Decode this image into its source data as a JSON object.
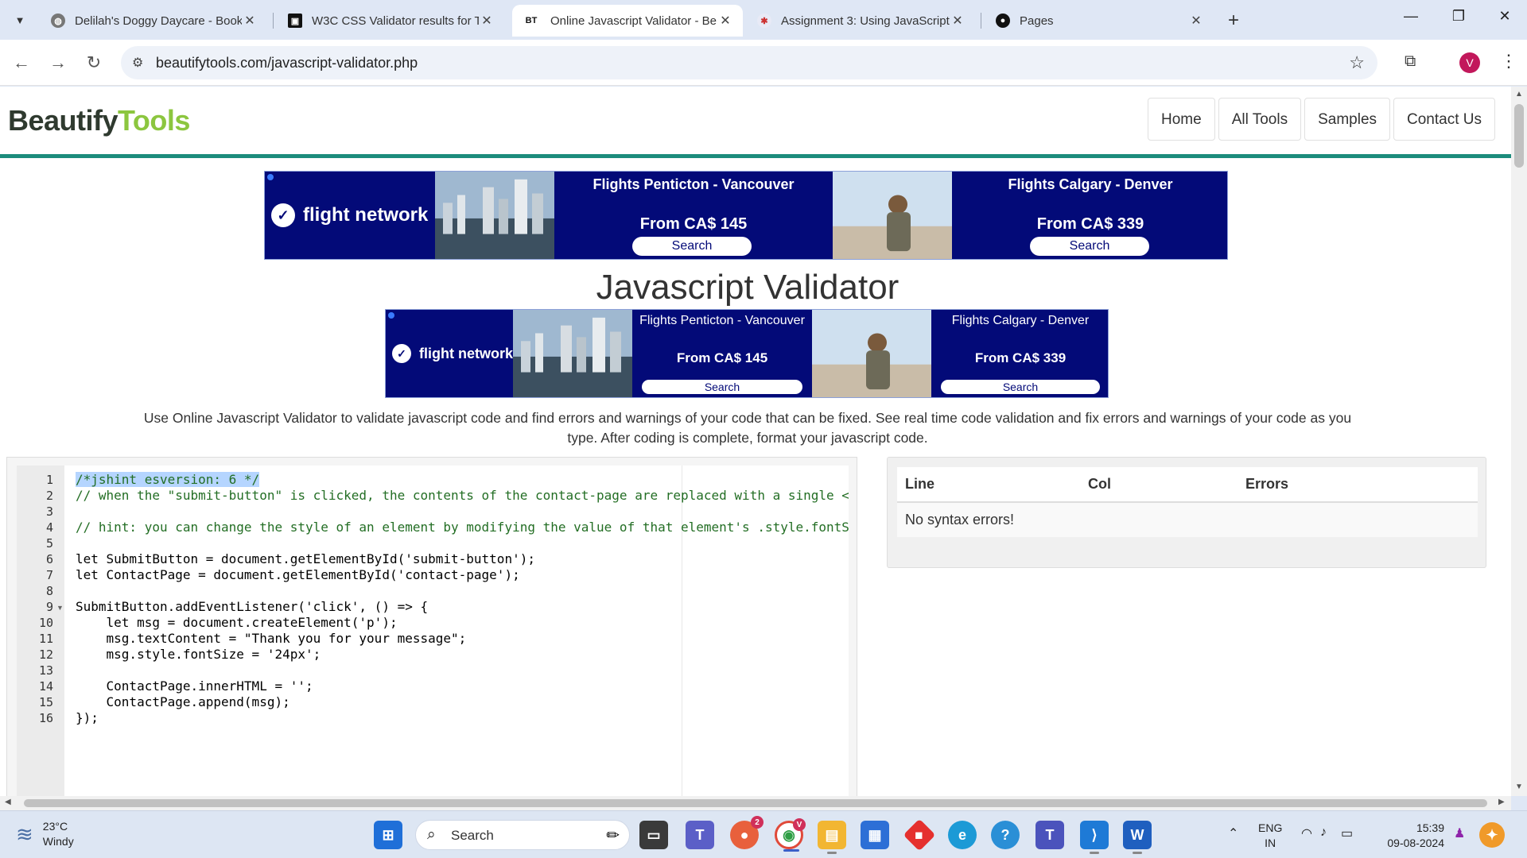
{
  "browser": {
    "tabs": [
      {
        "title": "Delilah's Doggy Daycare - Book",
        "favicon": "globe-icon"
      },
      {
        "title": "W3C CSS Validator results for T",
        "favicon": "w3c-icon"
      },
      {
        "title": "Online Javascript Validator - Be",
        "favicon": "bt-icon",
        "favicon_text": "BT"
      },
      {
        "title": "Assignment 3: Using JavaScript",
        "favicon": "assignment-icon"
      },
      {
        "title": "Pages",
        "favicon": "github-icon"
      }
    ],
    "url": "beautifytools.com/javascript-validator.php",
    "profile_initial": "V"
  },
  "site": {
    "logo_part1": "Beautify",
    "logo_part2": "Tools",
    "nav": [
      "Home",
      "All Tools",
      "Samples",
      "Contact Us"
    ],
    "heading": "Javascript Validator",
    "intro": "Use Online Javascript Validator to validate javascript code and find errors and warnings of your code that can be fixed. See real time code validation and fix errors and warnings of your code as you type. After coding is complete, format your javascript code."
  },
  "ads": [
    {
      "brand": "flight network",
      "deal1_route": "Flights Penticton - Vancouver",
      "deal1_price": "From CA$ 145",
      "deal1_button": "Search",
      "deal2_route": "Flights Calgary - Denver",
      "deal2_price": "From CA$ 339",
      "deal2_button": "Search"
    },
    {
      "brand": "flight network",
      "deal1_route": "Flights Penticton - Vancouver",
      "deal1_price": "From CA$ 145",
      "deal1_button": "Search",
      "deal2_route": "Flights Calgary - Denver",
      "deal2_price": "From CA$ 339",
      "deal2_button": "Search"
    }
  ],
  "editor": {
    "line_numbers": [
      "1",
      "2",
      "3",
      "4",
      "5",
      "6",
      "7",
      "8",
      "9",
      "10",
      "11",
      "12",
      "13",
      "14",
      "15",
      "16"
    ],
    "lines": [
      "/*jshint esversion: 6 */",
      "// when the \"submit-button\" is clicked, the contents of the contact-page are replaced with a single <p",
      "",
      "// hint: you can change the style of an element by modifying the value of that element's .style.fontSi",
      "",
      "let SubmitButton = document.getElementById('submit-button');",
      "let ContactPage = document.getElementById('contact-page');",
      "",
      "SubmitButton.addEventListener('click', () => {",
      "    let msg = document.createElement('p');",
      "    msg.textContent = \"Thank you for your message\";",
      "    msg.style.fontSize = '24px';",
      "",
      "    ContactPage.innerHTML = '';",
      "    ContactPage.append(msg);",
      "});"
    ]
  },
  "results": {
    "headers": [
      "Line",
      "Col",
      "Errors"
    ],
    "message": "No syntax errors!"
  },
  "taskbar": {
    "weather_temp": "23°C",
    "weather_desc": "Windy",
    "search_label": "Search",
    "lang_line1": "ENG",
    "lang_line2": "IN",
    "time": "15:39",
    "date": "09-08-2024",
    "chrome_badge": "V",
    "app_badge": "2"
  },
  "colors": {
    "accent_teal": "#1c8c7c",
    "logo_green": "#8cc63f",
    "ad_navy": "#030a78"
  }
}
